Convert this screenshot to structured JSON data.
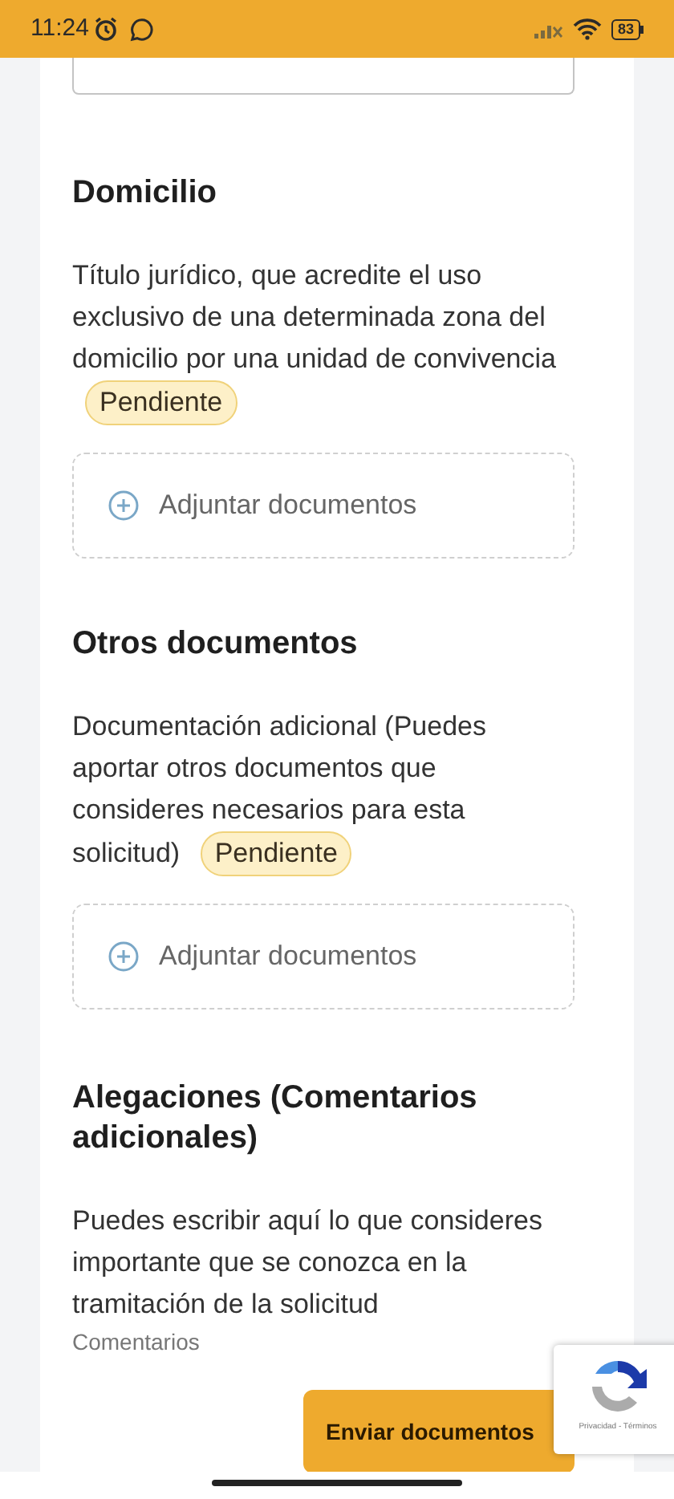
{
  "status_bar": {
    "time": "11:24",
    "battery": "83"
  },
  "sections": [
    {
      "title": "Domicilio",
      "description": "Título jurídico, que acredite el uso exclusivo de una determinada zona del domicilio por una unidad de convivencia",
      "badge": "Pendiente",
      "upload": "Adjuntar documentos"
    },
    {
      "title": "Otros documentos",
      "description": "Documentación adicional (Puedes aportar otros documentos que consideres necesarios para esta solicitud)",
      "badge": "Pendiente",
      "upload": "Adjuntar documentos"
    }
  ],
  "comments": {
    "title": "Alegaciones (Comentarios adicionales)",
    "description": "Puedes escribir aquí lo que consideres importante que se conozca en la tramitación de la solicitud",
    "label": "Comentarios"
  },
  "submit_button": "Enviar documentos",
  "recaptcha": {
    "links": "Privacidad - Términos"
  }
}
